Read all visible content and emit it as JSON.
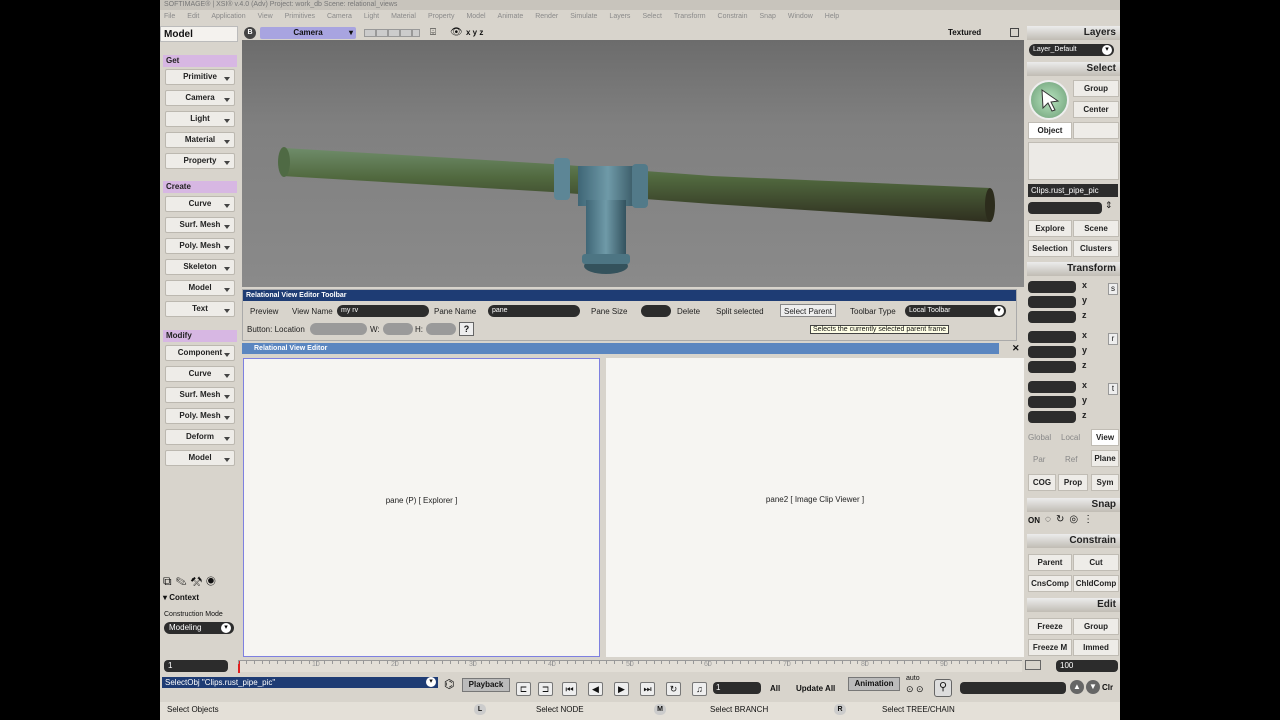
{
  "window_title": "SOFTIMAGE® | XSI® v.4.0 (Adv) Project: work_db   Scene: relational_views",
  "menu": [
    "File",
    "Edit",
    "Application",
    "View",
    "Primitives",
    "Camera",
    "Light",
    "Material",
    "Property",
    "Model",
    "Animate",
    "Render",
    "Simulate",
    "Layers",
    "Select",
    "Transform",
    "Constrain",
    "Snap",
    "Window",
    "Help"
  ],
  "left": {
    "title": "Model",
    "get_hdr": "Get",
    "get_items": [
      "Primitive",
      "Camera",
      "Light",
      "Material",
      "Property"
    ],
    "create_hdr": "Create",
    "create_items": [
      "Curve",
      "Surf. Mesh",
      "Poly. Mesh",
      "Skeleton",
      "Model",
      "Text"
    ],
    "modify_hdr": "Modify",
    "modify_items": [
      "Component",
      "Curve",
      "Surf. Mesh",
      "Poly. Mesh",
      "Deform",
      "Model"
    ],
    "context": "Context",
    "construction_mode_label": "Construction Mode",
    "construction_mode": "Modeling"
  },
  "viewport": {
    "letter": "B",
    "camera": "Camera",
    "mode": "Textured",
    "xyz": "x y z"
  },
  "rve_toolbar": {
    "title": "Relational View Editor Toolbar",
    "preview": "Preview",
    "view_name_label": "View Name",
    "view_name_value": "my rv",
    "pane_name_label": "Pane Name",
    "pane_name_value": "pane",
    "pane_size_label": "Pane Size",
    "delete": "Delete",
    "split_selected": "Split selected",
    "select_parent": "Select Parent",
    "toolbar_type_label": "Toolbar Type",
    "toolbar_type_value": "Local Toolbar",
    "button_location": "Button: Location",
    "w": "W:",
    "h": "H:",
    "help": "?",
    "tooltip": "Selects the currently selected parent frame"
  },
  "editor": {
    "title": "Relational View Editor",
    "pane1": "pane (P) [ Explorer ]",
    "pane2": "pane2 [ Image Clip Viewer ]",
    "close": "✕"
  },
  "right": {
    "layers_hdr": "Layers",
    "layer": "Layer_Default",
    "select_hdr": "Select",
    "group": "Group",
    "center": "Center",
    "object": "Object",
    "selected_obj": "Clips.rust_pipe_pic",
    "explore": "Explore",
    "scene": "Scene",
    "selection": "Selection",
    "clusters": "Clusters",
    "transform_hdr": "Transform",
    "s": "s",
    "r": "r",
    "t": "t",
    "global": "Global",
    "local": "Local",
    "view": "View",
    "par": "Par",
    "ref": "Ref",
    "plane": "Plane",
    "cog": "COG",
    "prop": "Prop",
    "sym": "Sym",
    "snap_hdr": "Snap",
    "on": "ON",
    "constrain_hdr": "Constrain",
    "parent": "Parent",
    "cut": "Cut",
    "cnscomp": "CnsComp",
    "chldcomp": "ChldComp",
    "edit_hdr": "Edit",
    "freeze": "Freeze",
    "group2": "Group",
    "freeze_m": "Freeze M",
    "immed": "Immed"
  },
  "timeline": {
    "start": "1",
    "end": "100",
    "ticks": [
      "10",
      "20",
      "30",
      "40",
      "50",
      "60",
      "70",
      "80",
      "90"
    ]
  },
  "playback": {
    "script": "SelectObj \"Clips.rust_pipe_pic\"",
    "playback": "Playback",
    "frame": "1",
    "all": "All",
    "update_all": "Update All",
    "animation": "Animation",
    "auto": "auto",
    "clr": "Clr"
  },
  "status": {
    "left": "Select Objects",
    "l": "L",
    "l_text": "Select NODE",
    "m": "M",
    "m_text": "Select BRANCH",
    "r": "R",
    "r_text": "Select TREE/CHAIN"
  }
}
